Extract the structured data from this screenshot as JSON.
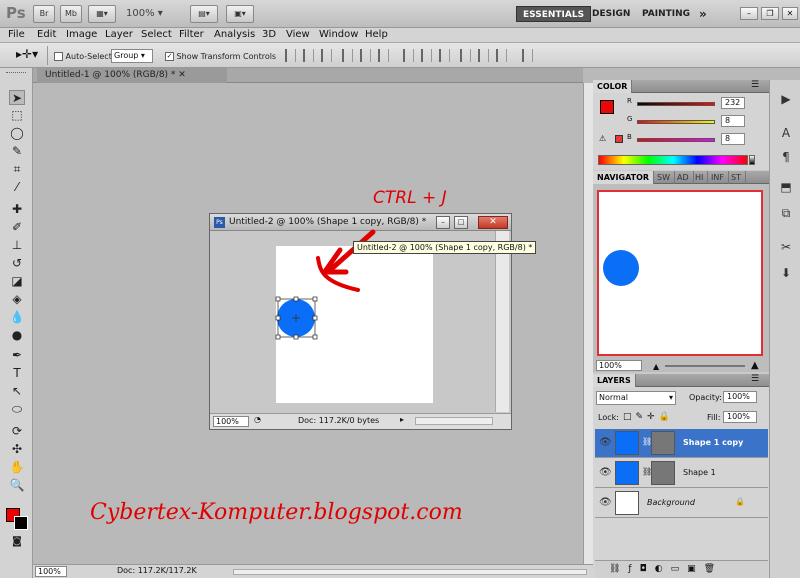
{
  "appbar": {
    "logo": "Ps",
    "br": "Br",
    "mb": "Mb",
    "zoom": "100%",
    "essentials": "ESSENTIALS",
    "design": "DESIGN",
    "painting": "PAINTING",
    "more": "»"
  },
  "menu": [
    "File",
    "Edit",
    "Image",
    "Layer",
    "Select",
    "Filter",
    "Analysis",
    "3D",
    "View",
    "Window",
    "Help"
  ],
  "options": {
    "auto_select": "Auto-Select:",
    "auto_select_value": "Group",
    "show_transform": "Show Transform Controls"
  },
  "doc_tab": "Untitled-1 @ 100% (RGB/8) *",
  "status": {
    "zoom": "100%",
    "doc": "Doc: 117.2K/117.2K"
  },
  "floating": {
    "title": "Untitled-2 @ 100% (Shape 1 copy, RGB/8) *",
    "zoom": "100%",
    "doc": "Doc: 117.2K/0 bytes",
    "tooltip": "Untitled-2 @ 100% (Shape 1 copy, RGB/8) *"
  },
  "annotation": "CTRL + J",
  "watermark": "Cybertex-Komputer.blogspot.com",
  "color_panel": {
    "title": "COLOR",
    "r_label": "R",
    "g_label": "G",
    "b_label": "B",
    "r": "232",
    "g": "8",
    "b": "8",
    "fg": "#e80808"
  },
  "navigator": {
    "tab": "NAVIGATOR",
    "tab2": "SW",
    "tab3": "AD",
    "tab4": "HI",
    "tab5": "INF",
    "tab6": "ST",
    "zoom": "100%"
  },
  "layers": {
    "title": "LAYERS",
    "blend": "Normal",
    "opacity_label": "Opacity:",
    "opacity": "100%",
    "lock_label": "Lock:",
    "fill_label": "Fill:",
    "fill": "100%",
    "items": [
      {
        "name": "Shape 1 copy",
        "selected": true
      },
      {
        "name": "Shape 1",
        "selected": false
      },
      {
        "name": "Background",
        "selected": false
      }
    ]
  },
  "colors": {
    "accent": "#3b73c8",
    "red": "#e00000",
    "shape": "#0a6ef7"
  }
}
